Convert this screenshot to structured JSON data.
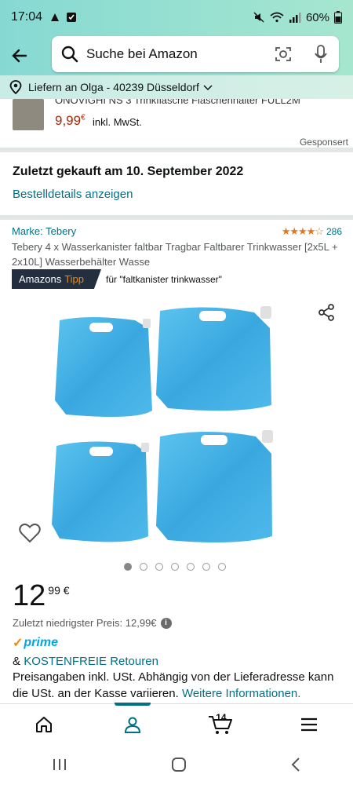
{
  "status_bar": {
    "time": "17:04",
    "battery": "60%"
  },
  "search": {
    "placeholder": "Suche bei Amazon"
  },
  "delivery": {
    "text": "Liefern an Olga - 40239 Düsseldorf"
  },
  "sponsored_item": {
    "title_cut": "ONOVIGHI NS 3 Trinkflasche Flaschenhalter FULL2M",
    "price": "9,99",
    "currency": "€",
    "incl": "inkl. MwSt.",
    "label": "Gesponsert"
  },
  "order": {
    "heading": "Zuletzt gekauft am 10. September 2022",
    "link": "Bestelldetails anzeigen"
  },
  "product": {
    "brand": "Marke: Tebery",
    "rating_count": "286",
    "title": "Tebery 4 x Wasserkanister faltbar Tragbar Faltbarer Trinkwasser [2x5L + 2x10L] Wasserbehälter Wasse",
    "tipp_a": "Amazons",
    "tipp_b": "Tipp",
    "tipp_for": "für \"faltkanister trinkwasser\"",
    "price_whole": "12",
    "price_frac": "99 €",
    "lowest": "Zuletzt niedrigster Preis: 12,99€",
    "prime": "prime",
    "returns_prefix": "& ",
    "returns_link": "KOSTENFREIE Retouren",
    "price_info": "Preisangaben inkl. USt. Abhängig von der Lieferadresse kann die USt. an der Kasse variieren.",
    "price_info_link": "Weitere Informationen."
  },
  "nav": {
    "cart_count": "14"
  },
  "colors": {
    "link": "#007185",
    "price_red": "#b12704",
    "prime_blue": "#00a8e1",
    "tipp_orange": "#f08804",
    "header": "#86d9d3"
  }
}
